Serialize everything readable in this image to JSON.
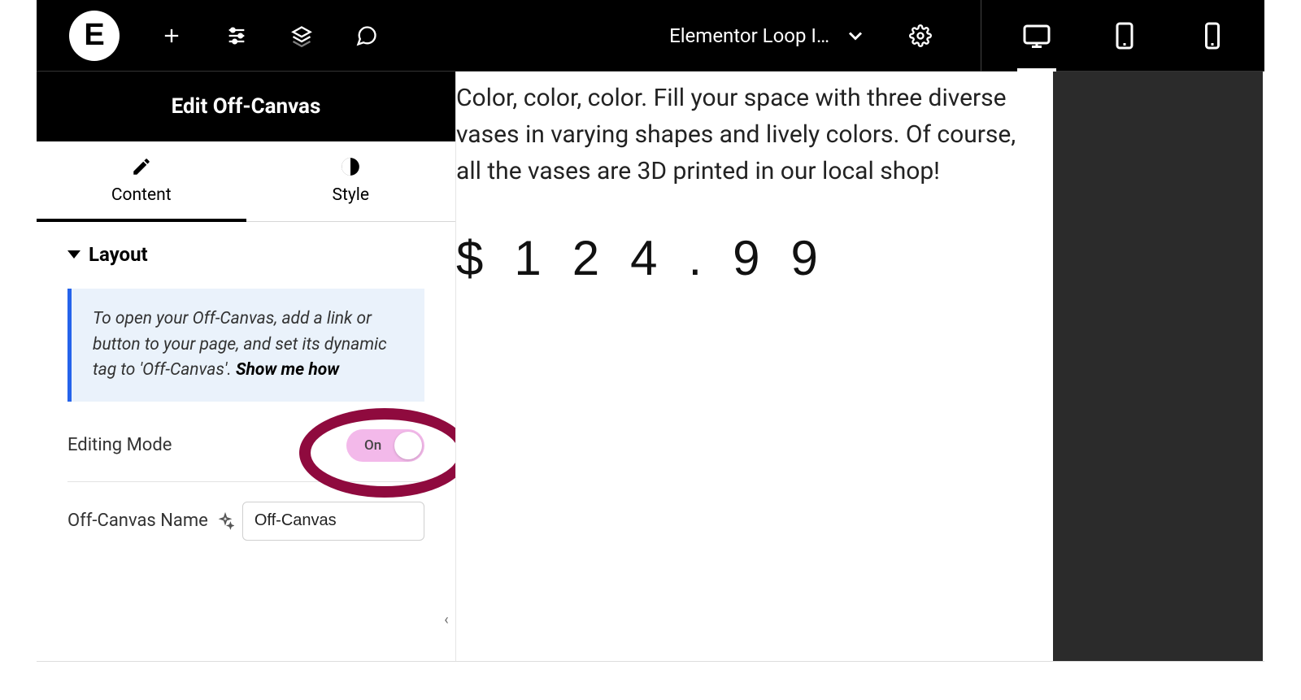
{
  "topbar": {
    "title": "Elementor Loop I…",
    "devices": {
      "desktop_active": true
    }
  },
  "sidebar": {
    "title": "Edit Off-Canvas",
    "tabs": {
      "content": "Content",
      "style": "Style"
    },
    "section": "Layout",
    "info_text": "To open your Off-Canvas, add a link or button to your page, and set its dynamic tag to 'Off-Canvas'. ",
    "info_link": "Show me how",
    "editing_mode": {
      "label": "Editing Mode",
      "state": "On"
    },
    "name_field": {
      "label": "Off-Canvas Name",
      "value": "Off-Canvas"
    }
  },
  "canvas": {
    "paragraph": "Color, color, color. Fill your space with three diverse vases in varying shapes and lively colors. Of course, all the vases are 3D printed in our local shop!",
    "price": "$124.99"
  }
}
